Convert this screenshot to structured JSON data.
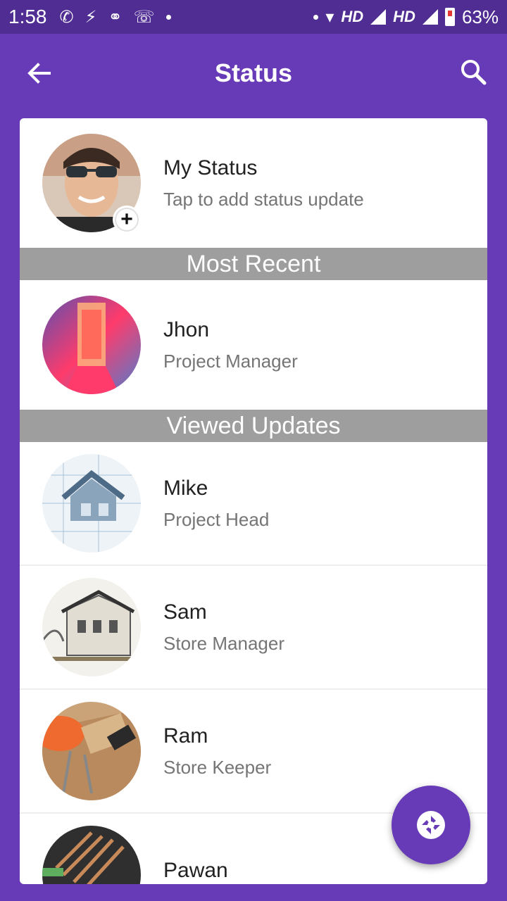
{
  "status_bar": {
    "time": "1:58",
    "hd1": "HD",
    "hd2": "HD",
    "battery": "63%"
  },
  "app_bar": {
    "title": "Status",
    "back_icon": "arrow-back-icon",
    "search_icon": "search-icon"
  },
  "my_status": {
    "name": "My Status",
    "subtitle": "Tap to add status update",
    "badge": "+"
  },
  "sections": {
    "most_recent": "Most Recent",
    "viewed_updates": "Viewed Updates"
  },
  "recent": [
    {
      "name": "Jhon",
      "subtitle": "Project Manager"
    }
  ],
  "viewed": [
    {
      "name": "Mike",
      "subtitle": "Project Head"
    },
    {
      "name": "Sam",
      "subtitle": "Store Manager"
    },
    {
      "name": "Ram",
      "subtitle": "Store Keeper"
    },
    {
      "name": "Pawan",
      "subtitle": ""
    }
  ],
  "fab": {
    "icon": "camera-shutter-icon"
  },
  "colors": {
    "primary": "#673ab7",
    "status_bar": "#4f2d93",
    "section_header": "#9e9e9e"
  }
}
